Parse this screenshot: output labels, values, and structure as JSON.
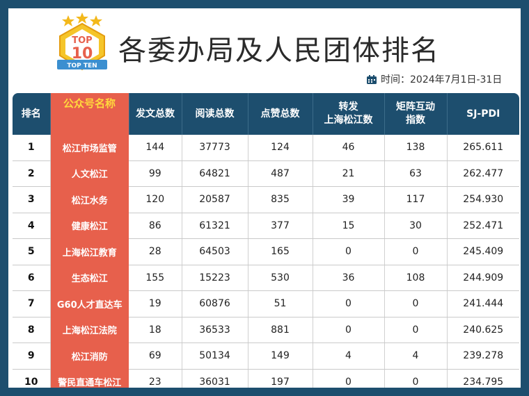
{
  "title": "各委办局及人民团体排名",
  "badge": {
    "top_text": "TOP",
    "number": "10",
    "ribbon": "TOP TEN"
  },
  "date": {
    "label": "时间：",
    "range": "2024年7月1日-31日"
  },
  "headers": {
    "rank": "排名",
    "name": "公众号名称",
    "posts": "发文总数",
    "reads": "阅读总数",
    "likes": "点赞总数",
    "repost_line1": "转发",
    "repost_line2": "上海松江数",
    "matrix_line1": "矩阵互动",
    "matrix_line2": "指数",
    "index": "SJ-PDI"
  },
  "rows": [
    {
      "rank": "1",
      "name": "松江市场监管",
      "posts": "144",
      "reads": "37773",
      "likes": "124",
      "repost": "46",
      "matrix": "138",
      "index": "265.611"
    },
    {
      "rank": "2",
      "name": "人文松江",
      "posts": "99",
      "reads": "64821",
      "likes": "487",
      "repost": "21",
      "matrix": "63",
      "index": "262.477"
    },
    {
      "rank": "3",
      "name": "松江水务",
      "posts": "120",
      "reads": "20587",
      "likes": "835",
      "repost": "39",
      "matrix": "117",
      "index": "254.930"
    },
    {
      "rank": "4",
      "name": "健康松江",
      "posts": "86",
      "reads": "61321",
      "likes": "377",
      "repost": "15",
      "matrix": "30",
      "index": "252.471"
    },
    {
      "rank": "5",
      "name": "上海松江教育",
      "posts": "28",
      "reads": "64503",
      "likes": "165",
      "repost": "0",
      "matrix": "0",
      "index": "245.409"
    },
    {
      "rank": "6",
      "name": "生态松江",
      "posts": "155",
      "reads": "15223",
      "likes": "530",
      "repost": "36",
      "matrix": "108",
      "index": "244.909"
    },
    {
      "rank": "7",
      "name": "G60人才直达车",
      "posts": "19",
      "reads": "60876",
      "likes": "51",
      "repost": "0",
      "matrix": "0",
      "index": "241.444"
    },
    {
      "rank": "8",
      "name": "上海松江法院",
      "posts": "18",
      "reads": "36533",
      "likes": "881",
      "repost": "0",
      "matrix": "0",
      "index": "240.625"
    },
    {
      "rank": "9",
      "name": "松江消防",
      "posts": "69",
      "reads": "50134",
      "likes": "149",
      "repost": "4",
      "matrix": "4",
      "index": "239.278"
    },
    {
      "rank": "10",
      "name": "警民直通车松江",
      "posts": "23",
      "reads": "36031",
      "likes": "197",
      "repost": "0",
      "matrix": "0",
      "index": "234.795"
    }
  ],
  "colors": {
    "header_bg": "#1d4e6e",
    "highlight_bg": "#e7604c",
    "highlight_text": "#ffd83d",
    "frame_bg": "#1d4e6e"
  }
}
